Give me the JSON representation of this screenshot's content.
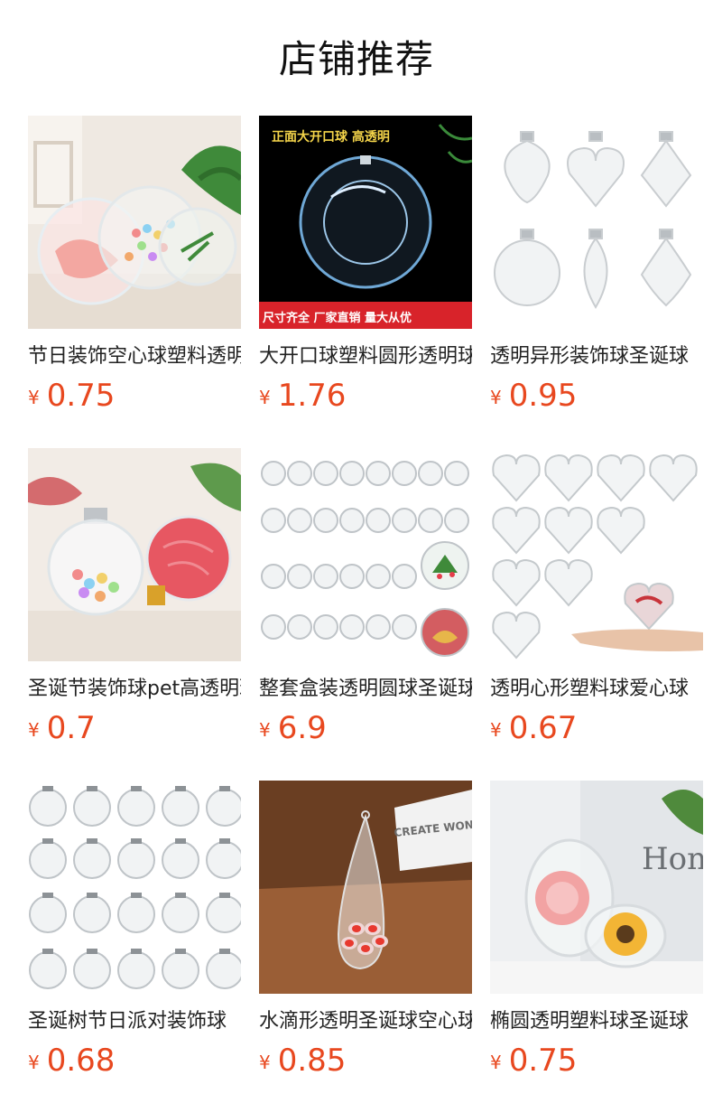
{
  "header": {
    "title": "店铺推荐"
  },
  "products": [
    {
      "name": "节日装饰空心球塑料透明球",
      "currency": "¥",
      "price": "0.75"
    },
    {
      "name": "大开口球塑料圆形透明球",
      "currency": "¥",
      "price": "1.76",
      "image_text": {
        "top": "正面大开口球   高透明",
        "bottom": "尺寸齐全   厂家直销   量大从优"
      }
    },
    {
      "name": "透明异形装饰球圣诞球",
      "currency": "¥",
      "price": "0.95"
    },
    {
      "name": "圣诞节装饰球pet高透明球",
      "currency": "¥",
      "price": "0.7"
    },
    {
      "name": "整套盒装透明圆球圣诞球",
      "currency": "¥",
      "price": "6.9"
    },
    {
      "name": "透明心形塑料球爱心球",
      "currency": "¥",
      "price": "0.67"
    },
    {
      "name": "圣诞树节日派对装饰球",
      "currency": "¥",
      "price": "0.68"
    },
    {
      "name": "水滴形透明圣诞球空心球",
      "currency": "¥",
      "price": "0.85",
      "image_text": {
        "box": "CREATE WONDERFUL"
      }
    },
    {
      "name": "椭圆透明塑料球圣诞球",
      "currency": "¥",
      "price": "0.75",
      "image_text": {
        "sign": "Hon"
      }
    }
  ],
  "colors": {
    "price": "#e8481f",
    "title": "#111111",
    "banner_bg": "#000000",
    "banner_red": "#d8232a",
    "banner_yellow": "#f5d54a"
  }
}
